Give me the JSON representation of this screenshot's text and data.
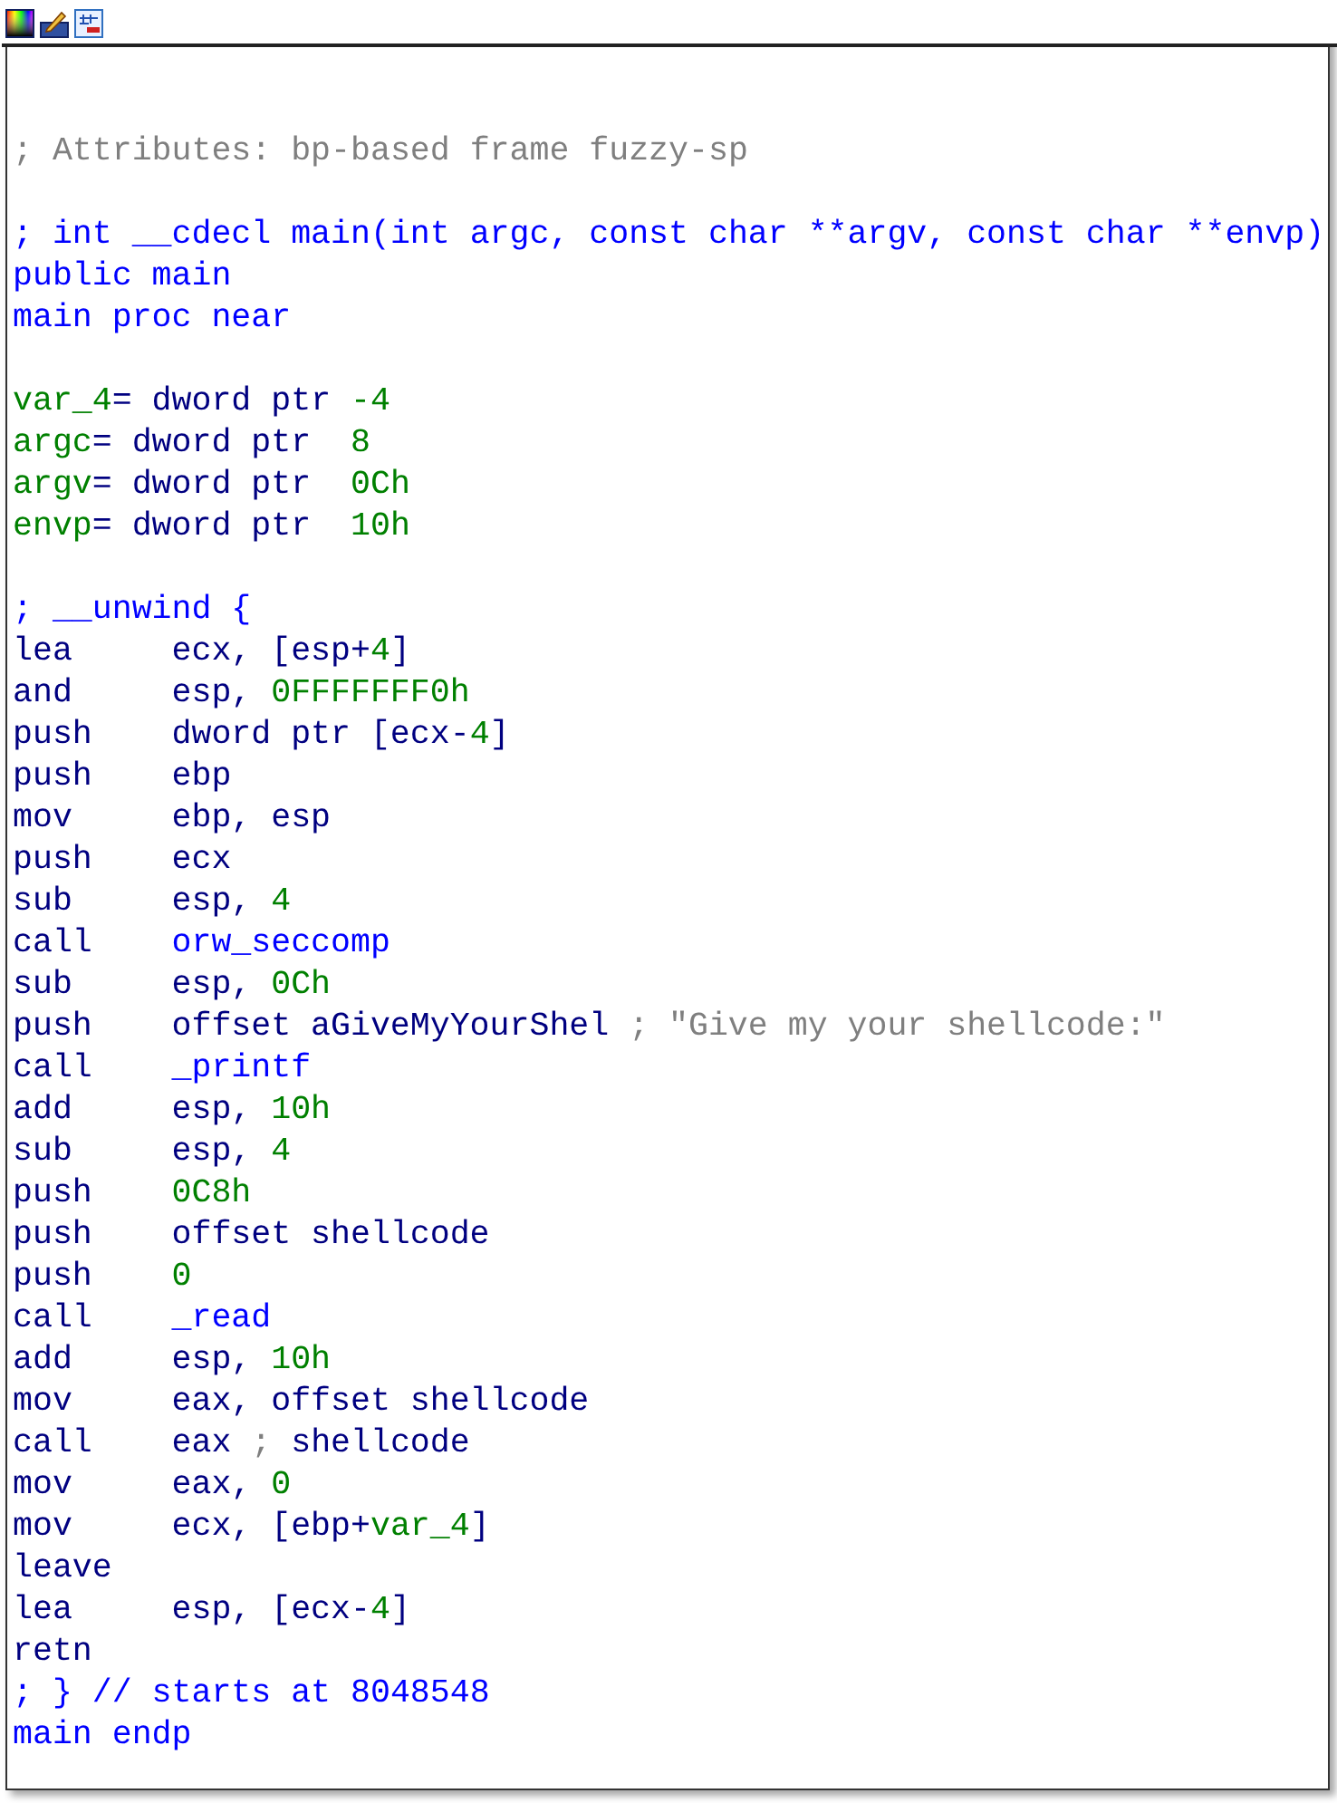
{
  "blocks": [
    {
      "lines": [
        {
          "segments": [
            {
              "text": "; Attributes: bp-based frame fuzzy-sp",
              "kind": "comment"
            }
          ]
        }
      ]
    },
    {
      "lines": [
        {
          "segments": [
            {
              "text": "; int __cdecl main(int argc, const char **argv, const char **envp)",
              "kind": "name"
            }
          ]
        },
        {
          "segments": [
            {
              "text": "public main",
              "kind": "name"
            }
          ]
        },
        {
          "segments": [
            {
              "text": "main proc near",
              "kind": "name"
            }
          ]
        }
      ]
    },
    {
      "lines": [
        {
          "segments": [
            {
              "text": "var_4",
              "kind": "number"
            },
            {
              "text": "= dword ptr ",
              "kind": "code"
            },
            {
              "text": "-4",
              "kind": "number"
            }
          ]
        },
        {
          "segments": [
            {
              "text": "argc",
              "kind": "number"
            },
            {
              "text": "= dword ptr  ",
              "kind": "code"
            },
            {
              "text": "8",
              "kind": "number"
            }
          ]
        },
        {
          "segments": [
            {
              "text": "argv",
              "kind": "number"
            },
            {
              "text": "= dword ptr  ",
              "kind": "code"
            },
            {
              "text": "0Ch",
              "kind": "number"
            }
          ]
        },
        {
          "segments": [
            {
              "text": "envp",
              "kind": "number"
            },
            {
              "text": "= dword ptr  ",
              "kind": "code"
            },
            {
              "text": "10h",
              "kind": "number"
            }
          ]
        }
      ]
    },
    {
      "lines": [
        {
          "segments": [
            {
              "text": "; __unwind {",
              "kind": "name"
            }
          ]
        },
        {
          "mnemonic": "lea",
          "segments": [
            {
              "text": "ecx, [esp+",
              "kind": "code"
            },
            {
              "text": "4",
              "kind": "number"
            },
            {
              "text": "]",
              "kind": "code"
            }
          ]
        },
        {
          "mnemonic": "and",
          "segments": [
            {
              "text": "esp, ",
              "kind": "code"
            },
            {
              "text": "0FFFFFFF0h",
              "kind": "number"
            }
          ]
        },
        {
          "mnemonic": "push",
          "segments": [
            {
              "text": "dword ptr [ecx-",
              "kind": "code"
            },
            {
              "text": "4",
              "kind": "number"
            },
            {
              "text": "]",
              "kind": "code"
            }
          ]
        },
        {
          "mnemonic": "push",
          "segments": [
            {
              "text": "ebp",
              "kind": "code"
            }
          ]
        },
        {
          "mnemonic": "mov",
          "segments": [
            {
              "text": "ebp, esp",
              "kind": "code"
            }
          ]
        },
        {
          "mnemonic": "push",
          "segments": [
            {
              "text": "ecx",
              "kind": "code"
            }
          ]
        },
        {
          "mnemonic": "sub",
          "segments": [
            {
              "text": "esp, ",
              "kind": "code"
            },
            {
              "text": "4",
              "kind": "number"
            }
          ]
        },
        {
          "mnemonic": "call",
          "segments": [
            {
              "text": "orw_seccomp",
              "kind": "name"
            }
          ]
        },
        {
          "mnemonic": "sub",
          "segments": [
            {
              "text": "esp, ",
              "kind": "code"
            },
            {
              "text": "0Ch",
              "kind": "number"
            }
          ]
        },
        {
          "mnemonic": "push",
          "segments": [
            {
              "text": "offset aGiveMyYourShel ",
              "kind": "code"
            },
            {
              "text": "; \"Give my your shellcode:\"",
              "kind": "comment"
            }
          ]
        },
        {
          "mnemonic": "call",
          "segments": [
            {
              "text": "_printf",
              "kind": "name"
            }
          ]
        },
        {
          "mnemonic": "add",
          "segments": [
            {
              "text": "esp, ",
              "kind": "code"
            },
            {
              "text": "10h",
              "kind": "number"
            }
          ]
        },
        {
          "mnemonic": "sub",
          "segments": [
            {
              "text": "esp, ",
              "kind": "code"
            },
            {
              "text": "4",
              "kind": "number"
            }
          ]
        },
        {
          "mnemonic": "push",
          "segments": [
            {
              "text": "0C8h",
              "kind": "number"
            }
          ]
        },
        {
          "mnemonic": "push",
          "segments": [
            {
              "text": "offset shellcode",
              "kind": "code"
            }
          ]
        },
        {
          "mnemonic": "push",
          "segments": [
            {
              "text": "0",
              "kind": "number"
            }
          ]
        },
        {
          "mnemonic": "call",
          "segments": [
            {
              "text": "_read",
              "kind": "name"
            }
          ]
        },
        {
          "mnemonic": "add",
          "segments": [
            {
              "text": "esp, ",
              "kind": "code"
            },
            {
              "text": "10h",
              "kind": "number"
            }
          ]
        },
        {
          "mnemonic": "mov",
          "segments": [
            {
              "text": "eax, offset shellcode",
              "kind": "code"
            }
          ]
        },
        {
          "mnemonic": "call",
          "segments": [
            {
              "text": "eax ",
              "kind": "code"
            },
            {
              "text": ";",
              "kind": "comment"
            },
            {
              "text": " shellcode",
              "kind": "code"
            }
          ]
        },
        {
          "mnemonic": "mov",
          "segments": [
            {
              "text": "eax, ",
              "kind": "code"
            },
            {
              "text": "0",
              "kind": "number"
            }
          ]
        },
        {
          "mnemonic": "mov",
          "segments": [
            {
              "text": "ecx, [ebp+",
              "kind": "code"
            },
            {
              "text": "var_4",
              "kind": "number"
            },
            {
              "text": "]",
              "kind": "code"
            }
          ]
        },
        {
          "mnemonic": "leave"
        },
        {
          "mnemonic": "lea",
          "segments": [
            {
              "text": "esp, [ecx-",
              "kind": "code"
            },
            {
              "text": "4",
              "kind": "number"
            },
            {
              "text": "]",
              "kind": "code"
            }
          ]
        },
        {
          "mnemonic": "retn"
        },
        {
          "segments": [
            {
              "text": "; } // starts at 8048548",
              "kind": "name"
            }
          ]
        },
        {
          "segments": [
            {
              "text": "main endp",
              "kind": "name"
            }
          ]
        }
      ]
    }
  ]
}
